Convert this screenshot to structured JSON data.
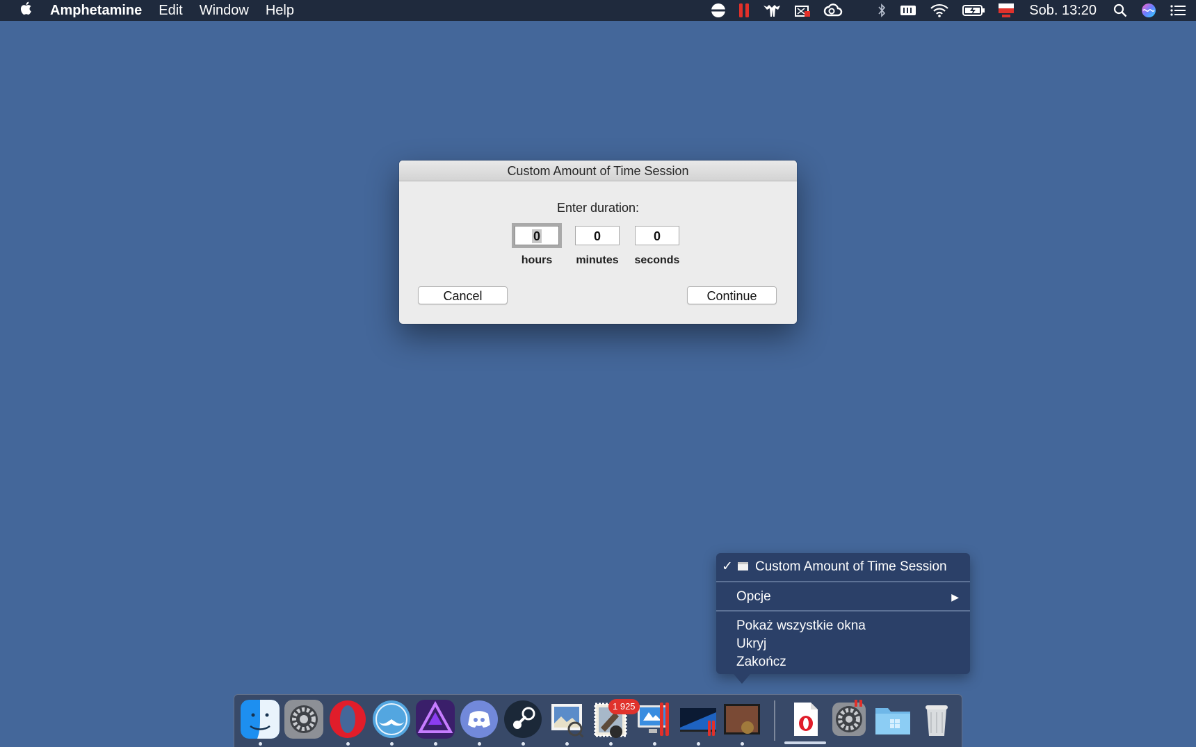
{
  "menubar": {
    "app_name": "Amphetamine",
    "items": [
      "Edit",
      "Window",
      "Help"
    ],
    "clock": "Sob. 13:20",
    "status_icons": [
      "amphetamine-pill-icon",
      "pause-bars-icon",
      "hammer-claw-icon",
      "screenshot-tool-icon",
      "creative-cloud-icon",
      "bluetooth-icon",
      "ram-chip-icon",
      "wifi-icon",
      "battery-icon",
      "flag-pro-icon",
      "spotlight-search-icon",
      "siri-icon",
      "notification-center-icon"
    ]
  },
  "dialog": {
    "title": "Custom Amount of Time Session",
    "prompt": "Enter duration:",
    "hours_value": "0",
    "minutes_value": "0",
    "seconds_value": "0",
    "hours_label": "hours",
    "minutes_label": "minutes",
    "seconds_label": "seconds",
    "cancel_label": "Cancel",
    "continue_label": "Continue"
  },
  "context_menu": {
    "window_item": "Custom Amount of Time Session",
    "check": "✓",
    "options": "Opcje",
    "show_all": "Pokaż wszystkie okna",
    "hide": "Ukryj",
    "quit": "Zakończ"
  },
  "dock": {
    "apps": [
      "finder-icon",
      "system-preferences-icon",
      "opera-icon",
      "mustache-app-icon",
      "affinity-photo-icon",
      "discord-icon",
      "steam-icon",
      "preview-icon",
      "mail-stamp-icon",
      "computer-screen-icon",
      "windows-desktop-icon",
      "amphetamine-window-icon",
      "opera-document-icon",
      "system-preferences-minimized-icon",
      "folder-icon",
      "trash-icon"
    ],
    "badge": "1 925"
  },
  "colors": {
    "desktop": "#44679a",
    "menubar": "#1f2a3d",
    "context_menu": "#2b4068",
    "dock": "#374664"
  }
}
